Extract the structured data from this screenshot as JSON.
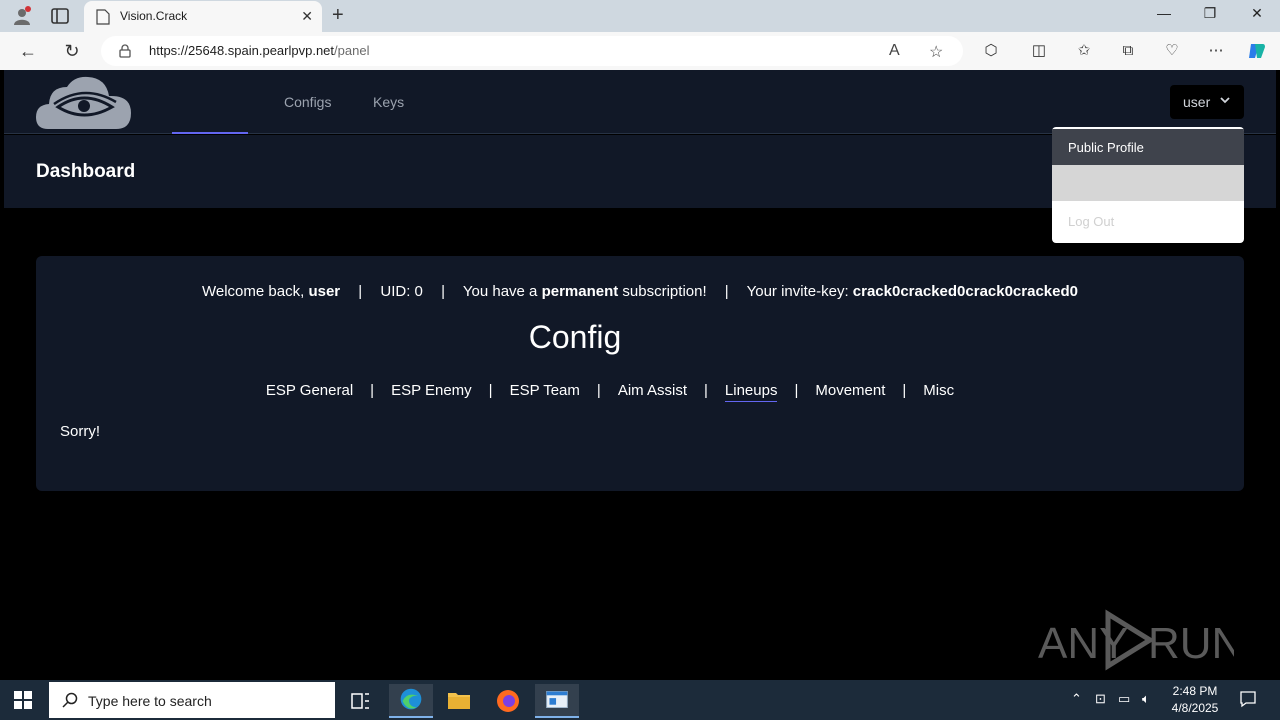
{
  "browser": {
    "tab_title": "Vision.Crack",
    "url_host": "https://25648.spain.pearlpvp.net",
    "url_path": "/panel"
  },
  "nav": {
    "links": [
      "Configs",
      "Keys"
    ],
    "user_label": "user"
  },
  "header": {
    "title": "Dashboard"
  },
  "dropdown": {
    "items": [
      "Public Profile",
      "",
      "Log Out"
    ]
  },
  "card": {
    "welcome_prefix": "Welcome back, ",
    "welcome_user": "user",
    "uid": "UID: 0",
    "sub_prefix": "You have a ",
    "sub_bold": "permanent",
    "sub_suffix": " subscription!",
    "invite_prefix": "Your invite-key: ",
    "invite_key": "crack0cracked0crack0cracked0",
    "separator": "|",
    "config_title": "Config",
    "tabs": [
      "ESP General",
      "ESP Enemy",
      "ESP Team",
      "Aim Assist",
      "Lineups",
      "Movement",
      "Misc"
    ],
    "active_tab": "Lineups",
    "message": "Sorry!"
  },
  "watermark": "ANY RUN",
  "taskbar": {
    "search_placeholder": "Type here to search",
    "time": "2:48 PM",
    "date": "4/8/2025"
  },
  "colors": {
    "accent": "#6366f1",
    "panel": "#111827"
  }
}
